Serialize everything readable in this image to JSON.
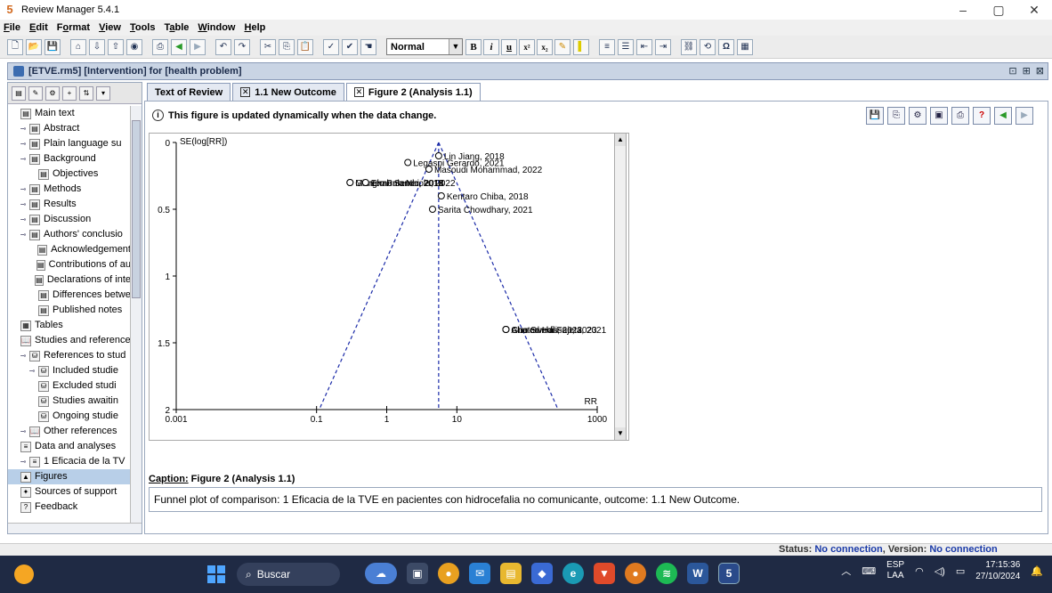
{
  "window": {
    "title": "Review Manager 5.4.1",
    "minimize": "–",
    "maximize": "▢",
    "close": "✕"
  },
  "menu": [
    {
      "label": "File",
      "key": "F"
    },
    {
      "label": "Edit",
      "key": "E"
    },
    {
      "label": "Format",
      "key": "o"
    },
    {
      "label": "View",
      "key": "V"
    },
    {
      "label": "Tools",
      "key": "T"
    },
    {
      "label": "Table",
      "key": "a"
    },
    {
      "label": "Window",
      "key": "W"
    },
    {
      "label": "Help",
      "key": "H"
    }
  ],
  "toolbar": {
    "style_value": "Normal",
    "bold": "B",
    "italic": "i",
    "underline": "u",
    "superscript": "x²",
    "subscript": "x₂"
  },
  "document": {
    "title": "[ETVE.rm5] [Intervention] for [health problem]"
  },
  "sidebar": {
    "items": [
      {
        "label": "Main text",
        "indent": 0,
        "exp": "",
        "icon": "doc"
      },
      {
        "label": "Abstract",
        "indent": 1,
        "exp": "o-",
        "icon": "doc"
      },
      {
        "label": "Plain language su",
        "indent": 1,
        "exp": "o-",
        "icon": "doc"
      },
      {
        "label": "Background",
        "indent": 1,
        "exp": "o-",
        "icon": "doc"
      },
      {
        "label": "Objectives",
        "indent": 2,
        "exp": "",
        "icon": "doc"
      },
      {
        "label": "Methods",
        "indent": 1,
        "exp": "o-",
        "icon": "doc"
      },
      {
        "label": "Results",
        "indent": 1,
        "exp": "o-",
        "icon": "doc"
      },
      {
        "label": "Discussion",
        "indent": 1,
        "exp": "o-",
        "icon": "doc"
      },
      {
        "label": "Authors' conclusio",
        "indent": 1,
        "exp": "o-",
        "icon": "doc"
      },
      {
        "label": "Acknowledgement",
        "indent": 2,
        "exp": "",
        "icon": "doc"
      },
      {
        "label": "Contributions of au",
        "indent": 2,
        "exp": "",
        "icon": "doc"
      },
      {
        "label": "Declarations of inte",
        "indent": 2,
        "exp": "",
        "icon": "doc"
      },
      {
        "label": "Differences betwe",
        "indent": 2,
        "exp": "",
        "icon": "doc"
      },
      {
        "label": "Published notes",
        "indent": 2,
        "exp": "",
        "icon": "doc"
      },
      {
        "label": "Tables",
        "indent": 0,
        "exp": "",
        "icon": "table"
      },
      {
        "label": "Studies and reference",
        "indent": 0,
        "exp": "",
        "icon": "book"
      },
      {
        "label": "References to stud",
        "indent": 1,
        "exp": "o-",
        "icon": "refs"
      },
      {
        "label": "Included studie",
        "indent": 2,
        "exp": "o-",
        "icon": "refs"
      },
      {
        "label": "Excluded studi",
        "indent": 2,
        "exp": "",
        "icon": "refs"
      },
      {
        "label": "Studies awaitin",
        "indent": 2,
        "exp": "",
        "icon": "refs"
      },
      {
        "label": "Ongoing studie",
        "indent": 2,
        "exp": "",
        "icon": "refs"
      },
      {
        "label": "Other references",
        "indent": 1,
        "exp": "o-",
        "icon": "book"
      },
      {
        "label": "Data and analyses",
        "indent": 0,
        "exp": "",
        "icon": "data"
      },
      {
        "label": "1 Eficacia de la TV",
        "indent": 1,
        "exp": "o-",
        "icon": "data"
      },
      {
        "label": "Figures",
        "indent": 0,
        "exp": "",
        "icon": "figure",
        "selected": true
      },
      {
        "label": "Sources of support",
        "indent": 0,
        "exp": "",
        "icon": "support"
      },
      {
        "label": "Feedback",
        "indent": 0,
        "exp": "",
        "icon": "feedback"
      }
    ]
  },
  "tabs": [
    {
      "label": "Text of Review",
      "closable": false,
      "active": false
    },
    {
      "label": "1.1 New Outcome",
      "closable": true,
      "active": false
    },
    {
      "label": "Figure 2 (Analysis 1.1)",
      "closable": true,
      "active": true
    }
  ],
  "figure": {
    "info": "This figure is updated dynamically when the data change.",
    "caption_label": "Caption:",
    "caption_title": "Figure 2 (Analysis 1.1)",
    "caption_text": "Funnel plot of comparison: 1 Eficacia de la TVE en pacientes con hidrocefalia no comunicante, outcome: 1.1 New Outcome."
  },
  "chart_data": {
    "type": "scatter",
    "subtype": "funnel",
    "xlabel": "RR",
    "ylabel": "SE(log[RR])",
    "x_scale": "log",
    "xlim": [
      0.001,
      1000
    ],
    "ylim": [
      0,
      2
    ],
    "y_inverted": true,
    "x_ticks": [
      "0.001",
      "0.1",
      "1",
      "10",
      "1000"
    ],
    "y_ticks": [
      "0",
      "0.5",
      "1",
      "1.5",
      "2"
    ],
    "pooled_rr": 5.5,
    "points": [
      {
        "label": "Lin Jiang, 2018",
        "x": 5.5,
        "y": 0.1
      },
      {
        "label": "Legaspi Gerardo, 2021",
        "x": 2.0,
        "y": 0.15
      },
      {
        "label": "Masoudi Mohammad, 2022",
        "x": 4.0,
        "y": 0.2
      },
      {
        "label": "Giorgio Palandri, 2018",
        "x": 0.3,
        "y": 0.3
      },
      {
        "label": "Montemurro Nicola, 2022",
        "x": 0.3,
        "y": 0.3
      },
      {
        "label": "Ehab Serrer, 2018",
        "x": 0.5,
        "y": 0.3
      },
      {
        "label": "Kentaro Chiba, 2018",
        "x": 6.0,
        "y": 0.4
      },
      {
        "label": "Sarita Chowdhary, 2021",
        "x": 4.5,
        "y": 0.5
      },
      {
        "label": "Guo Sunhili, 2023",
        "x": 50,
        "y": 1.4
      },
      {
        "label": "Chaturvedi Fujeta, 2021",
        "x": 50,
        "y": 1.4
      },
      {
        "label": "Ahmed Hassan, 2023",
        "x": 50,
        "y": 1.4
      }
    ],
    "grid": false,
    "legend": "none"
  },
  "status": {
    "label": "Status:",
    "connection": "No connection",
    "version_label": "Version:",
    "version": "No connection"
  },
  "taskbar": {
    "search_placeholder": "Buscar",
    "lang_top": "ESP",
    "lang_bottom": "LAA",
    "time": "17:15:36",
    "date": "27/10/2024"
  }
}
